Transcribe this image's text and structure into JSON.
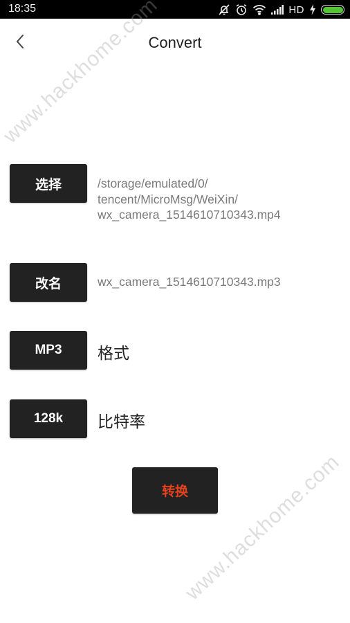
{
  "status_bar": {
    "time": "18:35",
    "icons": [
      "notifications-off-icon",
      "alarm-icon",
      "wifi-icon",
      "signal-icon",
      "charging-icon",
      "battery-icon"
    ],
    "network_label": "HD",
    "battery_level_percent": 100,
    "battery_color": "#55c434"
  },
  "header": {
    "back_icon": "chevron-left-icon",
    "title": "Convert"
  },
  "main": {
    "select_button": "选择",
    "source_path_lines": [
      "/storage/emulated/0/",
      "tencent/MicroMsg/WeiXin/",
      "wx_camera_1514610710343.mp4"
    ],
    "rename_button": "改名",
    "output_filename": "wx_camera_1514610710343.mp3",
    "format_button": "MP3",
    "format_label": "格式",
    "bitrate_button": "128k",
    "bitrate_label": "比特率",
    "convert_button": "转换",
    "convert_color": "#e2431e"
  },
  "watermark": {
    "text": "www.hackhome.com"
  }
}
